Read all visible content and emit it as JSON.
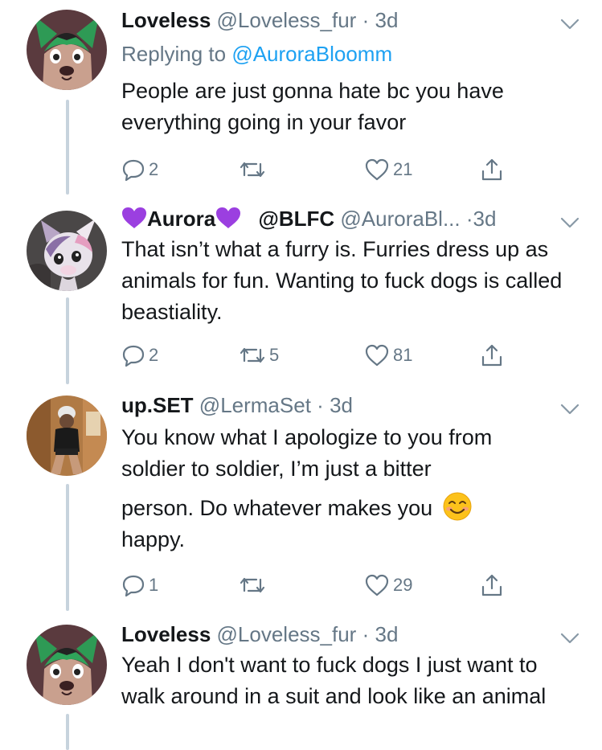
{
  "tweets": [
    {
      "name": "Loveless",
      "handle": "@Loveless_fur",
      "separator": "·",
      "time": "3d",
      "replying_prefix": "Replying to",
      "replying_handle": "@AuroraBloomm",
      "text": "People are just gonna hate bc you have everything going in your favor",
      "replies": "2",
      "retweets": "",
      "likes": "21",
      "avatar_icon": "green-fox-avatar-icon"
    },
    {
      "name": "Aurora",
      "name_emoji": "purple-heart-icon",
      "handle_prefix": "@BLFC",
      "handle": "@AuroraBl...",
      "separator": "·",
      "time": "3d",
      "text": "That isn’t what a furry is. Furries dress up as animals for fun. Wanting to fuck dogs is called beastiality.",
      "replies": "2",
      "retweets": "5",
      "likes": "81",
      "avatar_icon": "fursuit-avatar-icon"
    },
    {
      "name": "up.SET",
      "handle": "@LermaSet",
      "separator": "·",
      "time": "3d",
      "text_line1": "You know what I apologize to you from",
      "text_line2": "soldier to soldier, I’m just a bitter",
      "text_line3": "person. Do whatever makes you",
      "text_line4": "happy.",
      "emoji": "smiling-face-icon",
      "replies": "1",
      "retweets": "",
      "likes": "29",
      "avatar_icon": "person-photo-avatar-icon"
    },
    {
      "name": "Loveless",
      "handle": "@Loveless_fur",
      "separator": "·",
      "time": "3d",
      "text": "Yeah I don't want to fuck dogs I just want to walk around in a suit and look like an animal",
      "avatar_icon": "green-fox-avatar-icon"
    }
  ],
  "colors": {
    "text": "#14171a",
    "secondary": "#657786",
    "link": "#1da1f2",
    "thread_line": "#c7d3dd",
    "heart_emoji": "#9b3fe0"
  }
}
